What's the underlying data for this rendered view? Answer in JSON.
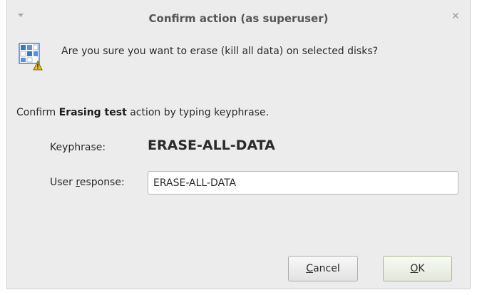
{
  "window": {
    "title": "Confirm action (as superuser)",
    "menu_icon": "chevron-down-icon",
    "close_icon": "close-icon"
  },
  "dialog": {
    "icon": "disk-warning-icon",
    "question": "Are you sure you want to erase (kill all data) on selected disks?",
    "confirm_prefix": "Confirm ",
    "confirm_action": "Erasing test",
    "confirm_suffix": " action by typing keyphrase.",
    "keyphrase_label": "Keyphrase:",
    "keyphrase_value": "ERASE-ALL-DATA",
    "response_label_pre": "User ",
    "response_label_mnemonic": "r",
    "response_label_post": "esponse:",
    "response_value": "ERASE-ALL-DATA"
  },
  "buttons": {
    "cancel_mnemonic": "C",
    "cancel_rest": "ancel",
    "ok_mnemonic": "O",
    "ok_rest": "K"
  },
  "colors": {
    "window_bg": "#ececec",
    "text": "#2b2b2b",
    "ok_border": "#a6b88f"
  }
}
